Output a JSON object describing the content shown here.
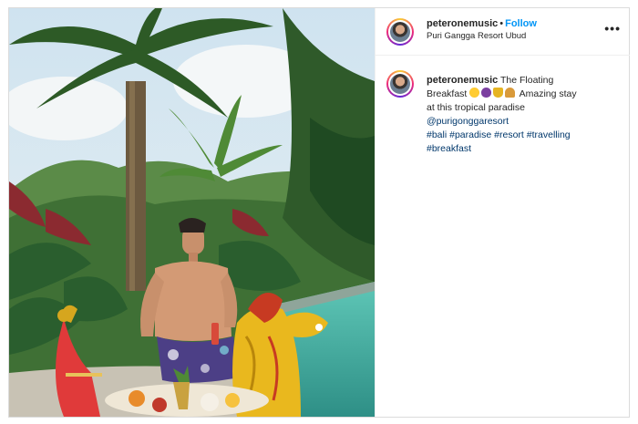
{
  "post": {
    "username": "peteronemusic",
    "separator": "•",
    "follow_label": "Follow",
    "location": "Puri Gangga Resort Ubud",
    "more_icon": "•••",
    "caption": {
      "username": "peteronemusic",
      "text_1": "The Floating",
      "text_2": "Breakfast",
      "emojis": [
        "star-struck-face",
        "eggplant",
        "trophy",
        "croissant"
      ],
      "text_3": "Amazing stay",
      "text_4": "at this tropical paradise",
      "mention": "@purigonggaresort",
      "hashtags_line1": [
        "#bali",
        "#paradise",
        "#resort",
        "#travelling"
      ],
      "hashtags_line2": [
        "#breakfast"
      ]
    }
  },
  "colors": {
    "follow_blue": "#0095f6",
    "hashtag_blue": "#00376b",
    "pool_teal": "#4fb8a6"
  }
}
